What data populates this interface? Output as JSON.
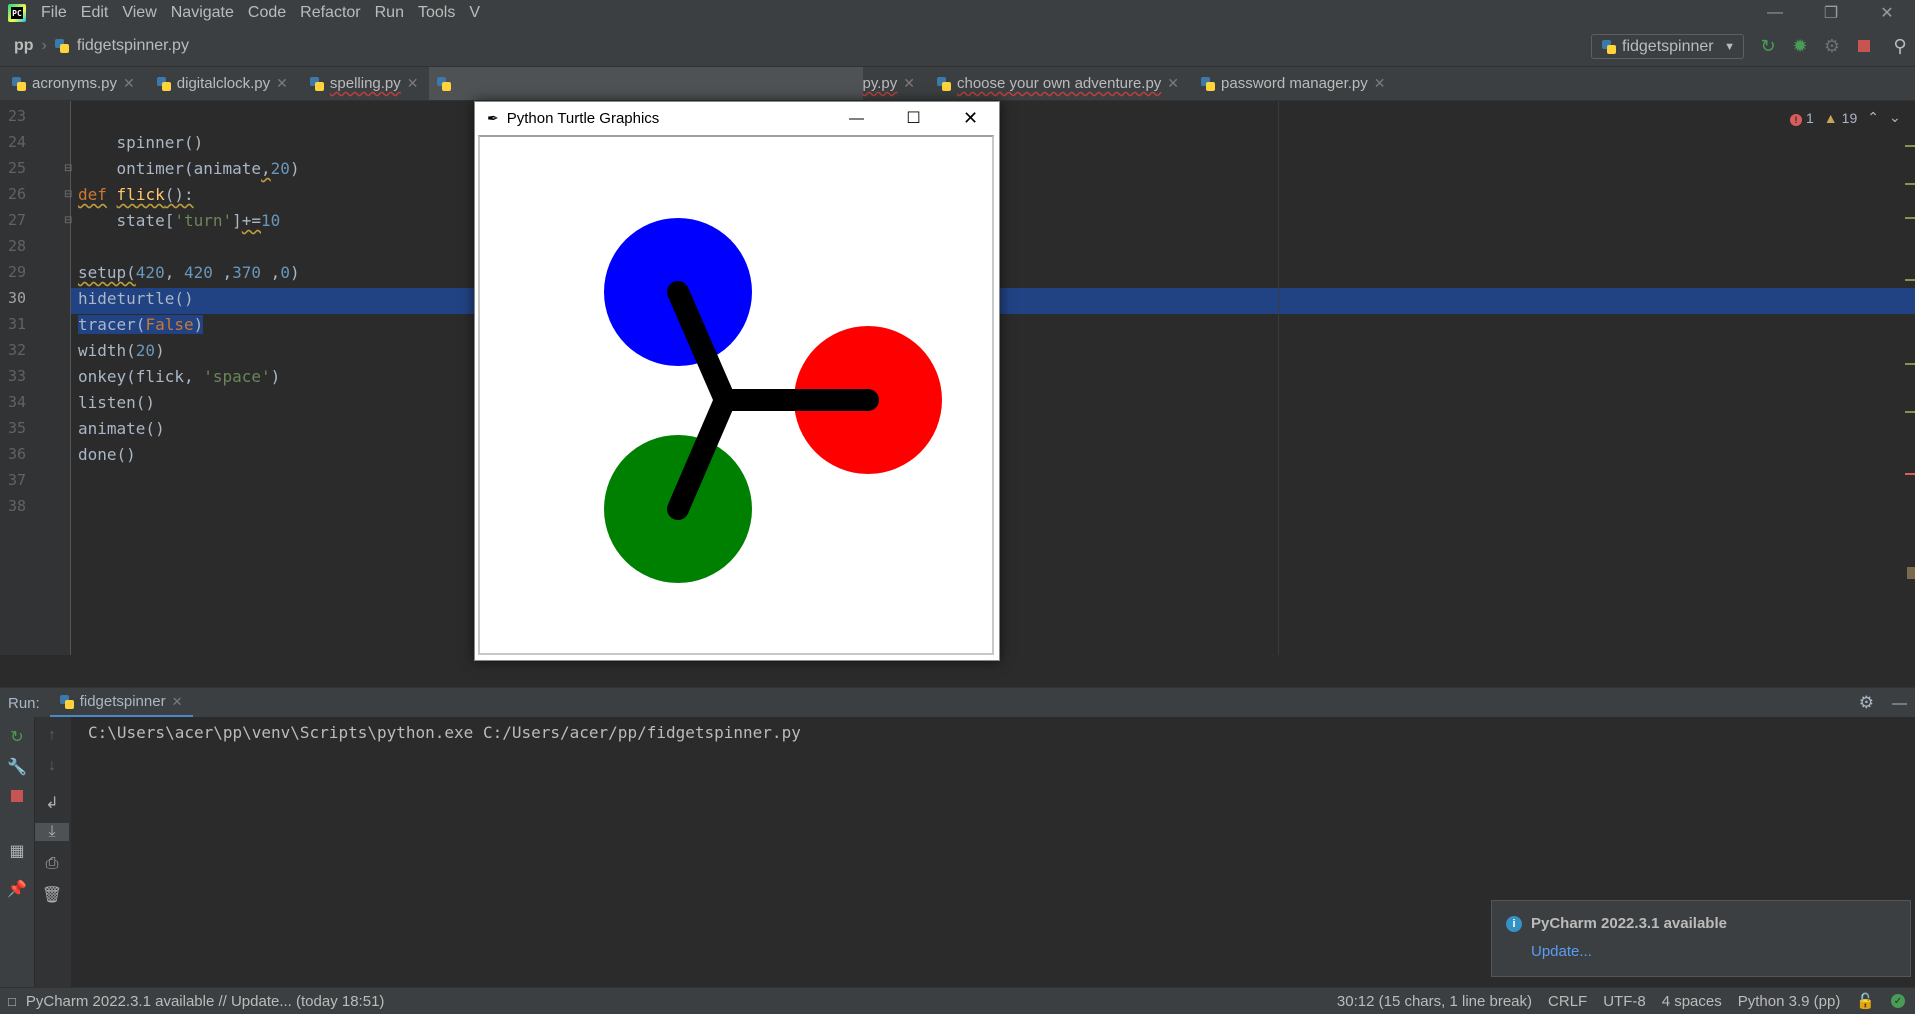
{
  "menubar": {
    "logo_text": "PC",
    "items": [
      "File",
      "Edit",
      "View",
      "Navigate",
      "Code",
      "Refactor",
      "Run",
      "Tools",
      "V"
    ]
  },
  "navbar": {
    "project": "pp",
    "file": "fidgetspinner.py",
    "run_config": "fidgetspinner"
  },
  "tabs": [
    {
      "label": "acronyms.py"
    },
    {
      "label": "digitalclock.py"
    },
    {
      "label": "spelling.py"
    },
    {
      "label": "py.py"
    },
    {
      "label": "choose your own adventure.py"
    },
    {
      "label": "password manager.py"
    }
  ],
  "editor": {
    "line_numbers": [
      "23",
      "24",
      "25",
      "26",
      "27",
      "28",
      "29",
      "30",
      "31",
      "32",
      "33",
      "34",
      "35",
      "36",
      "37",
      "38"
    ],
    "inspection": {
      "errors": "1",
      "warnings": "19"
    }
  },
  "turtle_window": {
    "title": "Python Turtle Graphics",
    "colors": {
      "top": "#0000ff",
      "right": "#ff0000",
      "bottom": "#008000",
      "arm": "#000000"
    }
  },
  "run_panel": {
    "label": "Run:",
    "tab": "fidgetspinner",
    "console": "C:\\Users\\acer\\pp\\venv\\Scripts\\python.exe C:/Users/acer/pp/fidgetspinner.py"
  },
  "notification": {
    "title": "PyCharm 2022.3.1 available",
    "action": "Update..."
  },
  "statusbar": {
    "message": "PyCharm 2022.3.1 available // Update... (today 18:51)",
    "position": "30:12 (15 chars, 1 line break)",
    "line_sep": "CRLF",
    "encoding": "UTF-8",
    "indent": "4 spaces",
    "interpreter": "Python 3.9 (pp)"
  }
}
